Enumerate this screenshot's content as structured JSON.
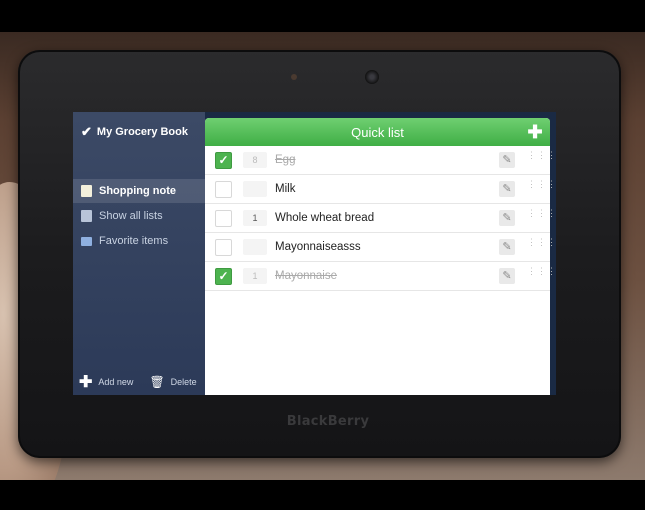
{
  "device": {
    "brand": "BlackBerry"
  },
  "sidebar": {
    "app_title": "My Grocery Book",
    "items": [
      {
        "label": "Shopping note",
        "active": true
      },
      {
        "label": "Show all lists",
        "active": false
      },
      {
        "label": "Favorite items",
        "active": false
      }
    ],
    "add_label": "Add new",
    "delete_label": "Delete"
  },
  "list": {
    "title": "Quick list",
    "items": [
      {
        "checked": true,
        "qty": "8",
        "name": "Egg"
      },
      {
        "checked": false,
        "qty": "",
        "name": "Milk"
      },
      {
        "checked": false,
        "qty": "1",
        "name": "Whole wheat bread"
      },
      {
        "checked": false,
        "qty": "",
        "name": "Mayonnaiseasss"
      },
      {
        "checked": true,
        "qty": "1",
        "name": "Mayonnaise"
      }
    ]
  },
  "colors": {
    "accent_green": "#4db34f",
    "sidebar_bg": "#2c3a58"
  }
}
